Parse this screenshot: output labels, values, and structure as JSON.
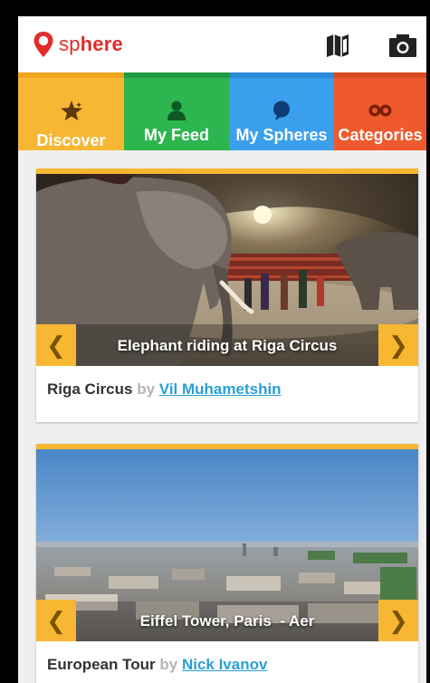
{
  "app": {
    "logo_prefix": "sp",
    "logo_suffix": "here",
    "brand_color": "#e12b2b",
    "icons": [
      "map-icon",
      "camera-icon"
    ]
  },
  "tabs": [
    {
      "label": "Discover",
      "icon": "star-icon",
      "color": "#f7b733"
    },
    {
      "label": "My Feed",
      "icon": "person-icon",
      "color": "#2db550"
    },
    {
      "label": "My Spheres",
      "icon": "speech-bubble-icon",
      "color": "#3aa0ee"
    },
    {
      "label": "Categories",
      "icon": "binoculars-icon",
      "color": "#ee5a2d"
    }
  ],
  "cards": [
    {
      "caption": "Elephant riding at Riga Circus",
      "title": "Riga Circus",
      "by": "by",
      "author": "Vil Muhametshin",
      "prev_label": "❮",
      "next_label": "❯"
    },
    {
      "caption": "Eiffel Tower, Paris  - Aer",
      "title": "European Tour",
      "by": "by",
      "author": "Nick Ivanov",
      "prev_label": "❮",
      "next_label": "❯"
    }
  ]
}
